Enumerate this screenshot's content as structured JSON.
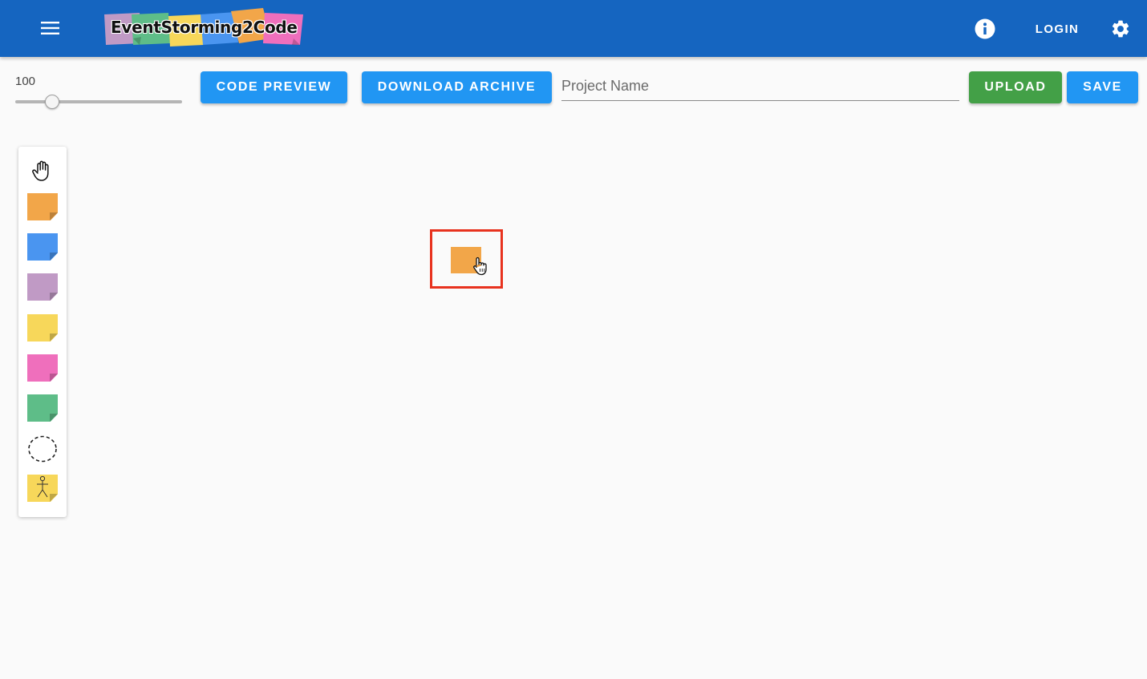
{
  "app": {
    "title": "EventStorming2Code"
  },
  "header": {
    "menu_icon": "hamburger-menu-icon",
    "info_icon": "info-icon",
    "login_label": "LOGIN",
    "settings_icon": "gear-icon",
    "bar_color": "#1565c0"
  },
  "toolbar": {
    "zoom_value": "100",
    "zoom_level": 100,
    "zoom_fraction": 0.22,
    "code_preview_label": "CODE PREVIEW",
    "download_archive_label": "DOWNLOAD ARCHIVE",
    "project_name_placeholder": "Project Name",
    "project_name_value": "",
    "upload_label": "UPLOAD",
    "save_label": "SAVE"
  },
  "palette": {
    "tools": [
      {
        "name": "hand-tool",
        "icon": "hand-icon"
      },
      {
        "name": "orange-sticky",
        "color": "#f2a649"
      },
      {
        "name": "blue-sticky",
        "color": "#4a95f0"
      },
      {
        "name": "purple-sticky",
        "color": "#c09ac5"
      },
      {
        "name": "yellow-sticky",
        "color": "#f7d75a"
      },
      {
        "name": "pink-sticky",
        "color": "#ef6fbc"
      },
      {
        "name": "green-sticky",
        "color": "#5ebd88"
      },
      {
        "name": "boundary-tool",
        "icon": "dashed-circle-icon"
      },
      {
        "name": "actor-sticky",
        "color": "#f7d75a",
        "icon": "stick-figure-icon"
      }
    ]
  },
  "canvas": {
    "notes": [
      {
        "color": "#f2a649",
        "highlight_color": "#e8321e"
      }
    ]
  },
  "colors": {
    "primary_button": "#2196f3",
    "upload_button": "#43a047",
    "background": "#fafafa"
  }
}
